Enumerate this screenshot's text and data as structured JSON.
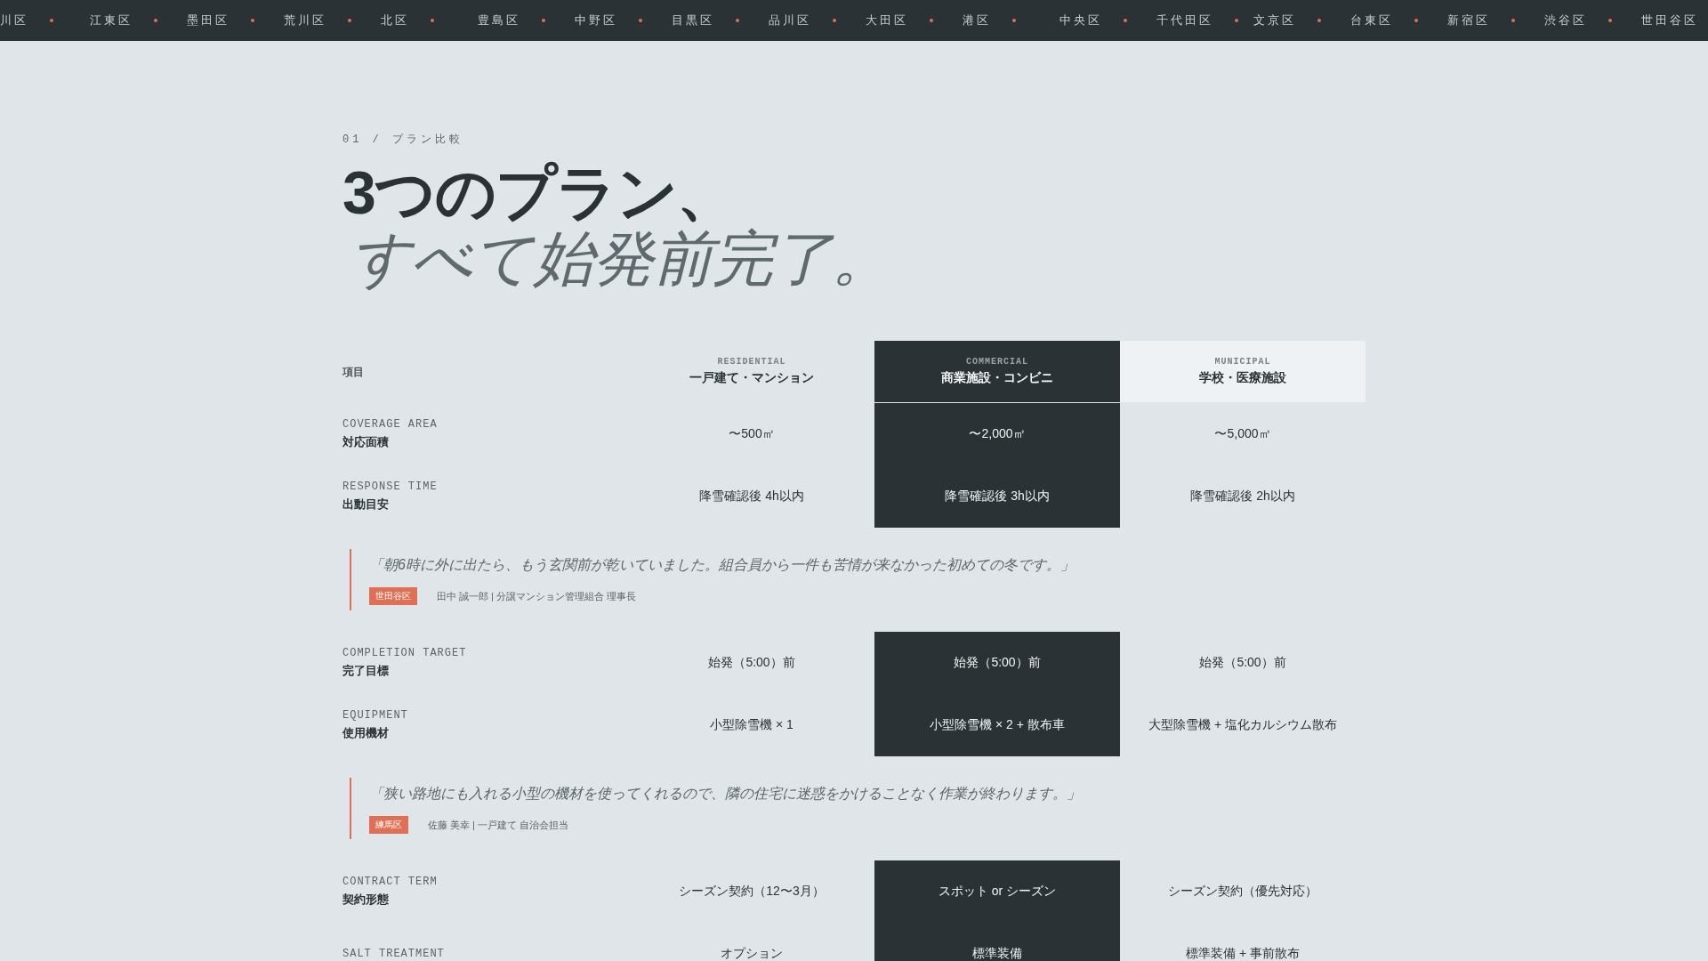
{
  "ticker": [
    "川区",
    "江東区",
    "墨田区",
    "荒川区",
    "北区",
    "豊島区",
    "中野区",
    "目黒区",
    "品川区",
    "大田区",
    "港区",
    "中央区",
    "千代田区",
    "文京区",
    "台東区",
    "新宿区",
    "渋谷区",
    "世田谷区"
  ],
  "eyebrow": "01 / プラン比較",
  "title": {
    "line1": "3つのプラン、",
    "line2": "すべて始発前完了。"
  },
  "table": {
    "corner": "項目",
    "plans": [
      {
        "code": "RESIDENTIAL",
        "name": "一戸建て・マンション",
        "kind": "plain"
      },
      {
        "code": "COMMERCIAL",
        "name": "商業施設・コンビニ",
        "kind": "dark"
      },
      {
        "code": "MUNICIPAL",
        "name": "学校・医療施設",
        "kind": "light"
      }
    ],
    "blocks": [
      {
        "kind": "rows",
        "rows": [
          {
            "en": "COVERAGE AREA",
            "ja": "対応面積",
            "values": [
              "〜500㎡",
              "〜2,000㎡",
              "〜5,000㎡"
            ]
          },
          {
            "en": "RESPONSE TIME",
            "ja": "出動目安",
            "values": [
              "降雪確認後 4h以内",
              "降雪確認後 3h以内",
              "降雪確認後 2h以内"
            ]
          }
        ]
      },
      {
        "kind": "quote",
        "text": "「朝6時に外に出たら、もう玄関前が乾いていました。組合員から一件も苦情が来なかった初めての冬です。」",
        "area": "世田谷区",
        "author": "田中 誠一郎 | 分譲マンション管理組合 理事長"
      },
      {
        "kind": "rows",
        "rows": [
          {
            "en": "COMPLETION TARGET",
            "ja": "完了目標",
            "values": [
              "始発（5:00）前",
              "始発（5:00）前",
              "始発（5:00）前"
            ]
          },
          {
            "en": "EQUIPMENT",
            "ja": "使用機材",
            "values": [
              "小型除雪機 × 1",
              "小型除雪機 × 2 + 散布車",
              "大型除雪機 + 塩化カルシウム散布"
            ]
          }
        ]
      },
      {
        "kind": "quote",
        "text": "「狭い路地にも入れる小型の機材を使ってくれるので、隣の住宅に迷惑をかけることなく作業が終わります。」",
        "area": "練馬区",
        "author": "佐藤 美幸 | 一戸建て 自治会担当"
      },
      {
        "kind": "rows",
        "rows": [
          {
            "en": "CONTRACT TERM",
            "ja": "契約形態",
            "values": [
              "シーズン契約（12〜3月）",
              "スポット or シーズン",
              "シーズン契約（優先対応）"
            ]
          },
          {
            "en": "SALT TREATMENT",
            "values": [
              "オプション",
              "標準装備",
              "標準装備 + 事前散布"
            ]
          }
        ]
      }
    ]
  }
}
